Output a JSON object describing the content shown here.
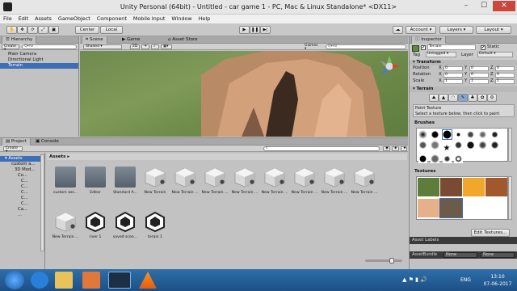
{
  "window": {
    "title": "Unity Personal (64bit) - Untitled - car game 1 - PC, Mac & Linux Standalone* <DX11>"
  },
  "menu": [
    "File",
    "Edit",
    "Assets",
    "GameObject",
    "Component",
    "Mobile Input",
    "Window",
    "Help"
  ],
  "toolbar": {
    "center": "Center",
    "local": "Local",
    "account": "Account",
    "layers": "Layers",
    "layout": "Layout"
  },
  "hierarchy": {
    "tab": "Hierarchy",
    "create": "Create",
    "search_placeholder": "Q▾All",
    "items": [
      "Main Camera",
      "Directional Light",
      "Terrain"
    ],
    "selected": "Terrain"
  },
  "scene": {
    "tabs": [
      "Scene",
      "Game",
      "Asset Store"
    ],
    "shading": "Shaded",
    "mode2d": "2D",
    "gizmos": "Gizmos ▾",
    "search_placeholder": "Q▾All"
  },
  "project": {
    "tabs": [
      "Project",
      "Console"
    ],
    "create": "Create",
    "tree": [
      "Assets",
      "custom a...",
      "3D Mod...",
      "Co...",
      "C...",
      "C...",
      "C...",
      "C...",
      "C...",
      "Ca...",
      "..."
    ],
    "breadcrumb": "Assets ▸",
    "assets": [
      {
        "label": "custom ass...",
        "kind": "folder"
      },
      {
        "label": "Editor",
        "kind": "folder"
      },
      {
        "label": "Standard A...",
        "kind": "folder"
      },
      {
        "label": "New Terrain",
        "kind": "terrain"
      },
      {
        "label": "New Terrain ...",
        "kind": "terrain"
      },
      {
        "label": "New Terrain ...",
        "kind": "terrain"
      },
      {
        "label": "New Terrain ...",
        "kind": "terrain"
      },
      {
        "label": "New Terrain ...",
        "kind": "terrain"
      },
      {
        "label": "New Terrain ...",
        "kind": "terrain"
      },
      {
        "label": "New Terrain ...",
        "kind": "terrain"
      },
      {
        "label": "New Terrain ...",
        "kind": "terrain"
      },
      {
        "label": "New Terrain ...",
        "kind": "terrain"
      },
      {
        "label": "river 1",
        "kind": "unity"
      },
      {
        "label": "saved scen...",
        "kind": "unity"
      },
      {
        "label": "terain 1",
        "kind": "unity"
      }
    ]
  },
  "inspector": {
    "tab": "Inspector",
    "name": "Terrain",
    "static": "Static",
    "tag_label": "Tag",
    "tag": "Untagged",
    "layer_label": "Layer",
    "layer": "Default",
    "transform": {
      "title": "Transform",
      "rows": [
        {
          "label": "Position",
          "x": "0",
          "y": "0",
          "z": "0"
        },
        {
          "label": "Rotation",
          "x": "0",
          "y": "0",
          "z": "0"
        },
        {
          "label": "Scale",
          "x": "1",
          "y": "1",
          "z": "1"
        }
      ]
    },
    "terrain": {
      "title": "Terrain",
      "tool": "Paint Texture",
      "hint": "Select a texture below, then click to paint",
      "brushes_label": "Brushes",
      "textures_label": "Textures",
      "edit_textures": "Edit Textures...",
      "texture_colors": [
        "#5f7d3a",
        "#7a4a33",
        "#f2a62a",
        "#a0582c",
        "#e6b08a",
        "#6d5a48"
      ]
    },
    "asset_labels": "Asset Labels",
    "asset_bundle_label": "AssetBundle",
    "asset_bundle": "None",
    "asset_bundle_variant": "None"
  },
  "taskbar": {
    "time": "13:10",
    "date": "07-06-2017",
    "lang": "ENG"
  }
}
